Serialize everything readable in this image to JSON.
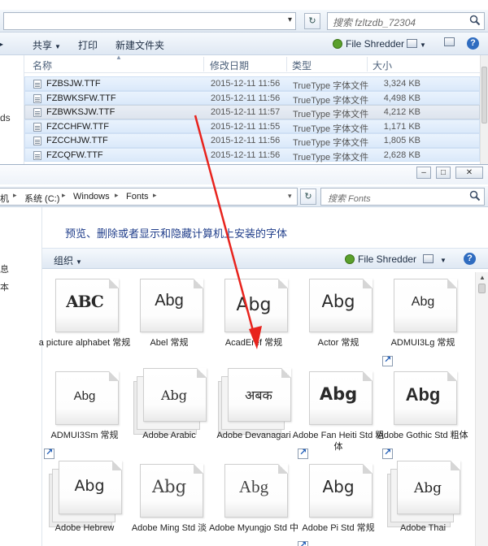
{
  "back_window": {
    "address": {
      "path": "",
      "dropdown_icon": "chevron-down-icon"
    },
    "search": {
      "placeholder": "搜索 fzltzdb_72304"
    },
    "toolbar": {
      "organize": "共享",
      "print": "打印",
      "new_folder": "新建文件夹",
      "shredder": "File Shredder"
    },
    "left_pane_text": "ds",
    "columns": {
      "name": "名称",
      "date": "修改日期",
      "type": "类型",
      "size": "大小"
    },
    "files": [
      {
        "name": "FZBSJW.TTF",
        "date": "2015-12-11 11:56",
        "type": "TrueType 字体文件",
        "size": "3,324 KB"
      },
      {
        "name": "FZBWKSFW.TTF",
        "date": "2015-12-11 11:56",
        "type": "TrueType 字体文件",
        "size": "4,498 KB"
      },
      {
        "name": "FZBWKSJW.TTF",
        "date": "2015-12-11 11:57",
        "type": "TrueType 字体文件",
        "size": "4,212 KB"
      },
      {
        "name": "FZCCHFW.TTF",
        "date": "2015-12-11 11:55",
        "type": "TrueType 字体文件",
        "size": "1,171 KB"
      },
      {
        "name": "FZCCHJW.TTF",
        "date": "2015-12-11 11:56",
        "type": "TrueType 字体文件",
        "size": "1,805 KB"
      },
      {
        "name": "FZCQFW.TTF",
        "date": "2015-12-11 11:56",
        "type": "TrueType 字体文件",
        "size": "2,628 KB"
      }
    ]
  },
  "front_window": {
    "breadcrumbs": [
      "机",
      "系统 (C:)",
      "Windows",
      "Fonts"
    ],
    "search": {
      "placeholder": "搜索 Fonts"
    },
    "left_pane_texts": [
      "息",
      "本"
    ],
    "heading": "预览、删除或者显示和隐藏计算机上安装的字体",
    "toolbar": {
      "organize": "组织",
      "shredder": "File Shredder"
    },
    "fonts": [
      {
        "sample": "ABC",
        "label": "a picture alphabet 常规",
        "stack": false,
        "shortcut": false
      },
      {
        "sample": "Abg",
        "label": "Abel 常规",
        "stack": false,
        "shortcut": false
      },
      {
        "sample": "Abg",
        "label": "AcadEref 常规",
        "stack": false,
        "shortcut": false
      },
      {
        "sample": "Abg",
        "label": "Actor 常规",
        "stack": false,
        "shortcut": false
      },
      {
        "sample": "Abg",
        "label": "ADMUI3Lg 常规",
        "stack": false,
        "shortcut": true
      },
      {
        "sample": "Abg",
        "label": "ADMUI3Sm 常规",
        "stack": false,
        "shortcut": true
      },
      {
        "sample": "Abg",
        "label": "Adobe Arabic",
        "stack": true,
        "shortcut": false
      },
      {
        "sample": "अबक",
        "label": "Adobe Devanagari",
        "stack": true,
        "shortcut": false
      },
      {
        "sample": "Abg",
        "label": "Adobe Fan Heiti Std 粗体",
        "stack": false,
        "shortcut": true
      },
      {
        "sample": "Abg",
        "label": "Adobe Gothic Std 粗体",
        "stack": false,
        "shortcut": true
      },
      {
        "sample": "Abg",
        "label": "Adobe Hebrew",
        "stack": true,
        "shortcut": false
      },
      {
        "sample": "Abg",
        "label": "Adobe Ming Std 淡",
        "stack": false,
        "shortcut": false
      },
      {
        "sample": "Abg",
        "label": "Adobe Myungjo Std 中",
        "stack": false,
        "shortcut": false
      },
      {
        "sample": "Abg",
        "label": "Adobe Pi Std 常规",
        "stack": false,
        "shortcut": true
      },
      {
        "sample": "Abg",
        "label": "Adobe Thai",
        "stack": true,
        "shortcut": false
      }
    ]
  },
  "annotation": {
    "arrow_color": "#e8231d"
  },
  "colors": {
    "heading": "#1f3d8a",
    "selection": "#dbe9fa",
    "shredder": "#5aa02c",
    "help": "#2f6cc0"
  }
}
